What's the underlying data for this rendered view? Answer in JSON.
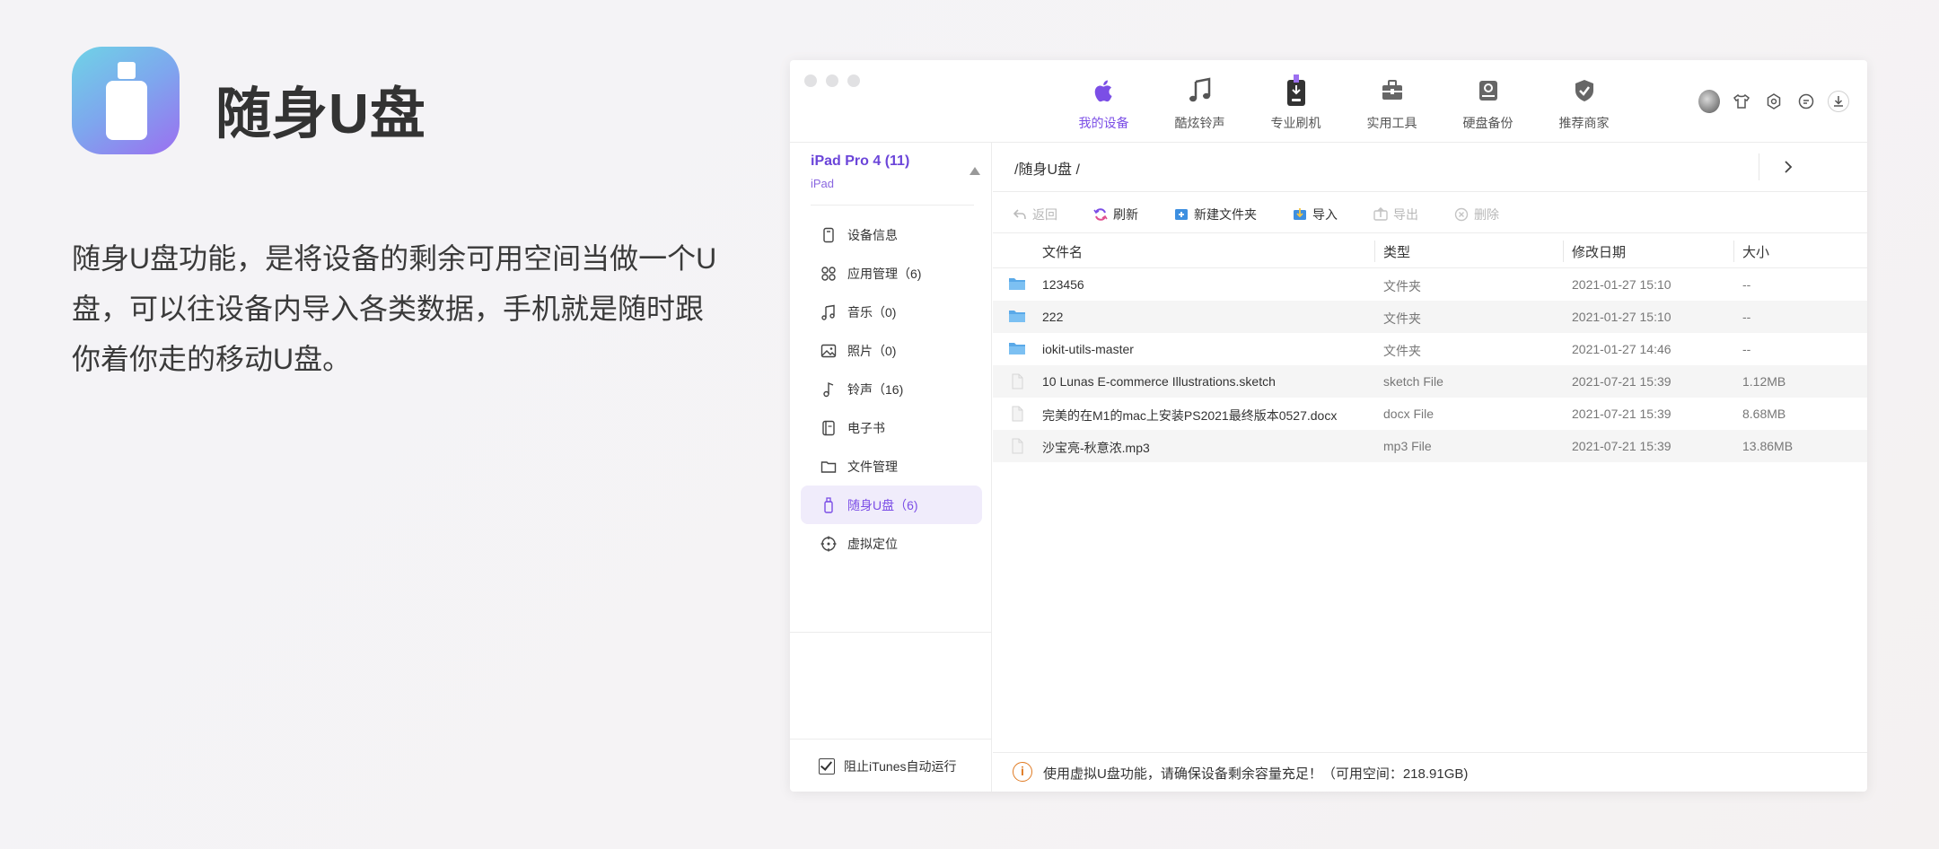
{
  "hero": {
    "title": "随身U盘",
    "description": "随身U盘功能，是将设备的剩余可用空间当做一个U盘，可以往设备内导入各类数据，手机就是随时跟你着你走的移动U盘。"
  },
  "colors": {
    "accent": "#7b4ee6",
    "folder": "#5aa9e8",
    "warning": "#e07a22"
  },
  "nav": {
    "tabs": [
      {
        "label": "我的设备",
        "icon": "apple-icon",
        "active": true
      },
      {
        "label": "酷炫铃声",
        "icon": "music-note-icon"
      },
      {
        "label": "专业刷机",
        "icon": "phone-flash-icon"
      },
      {
        "label": "实用工具",
        "icon": "toolbox-icon"
      },
      {
        "label": "硬盘备份",
        "icon": "hard-drive-backup-icon"
      },
      {
        "label": "推荐商家",
        "icon": "shield-check-icon"
      }
    ]
  },
  "device": {
    "name": "iPad Pro 4 (11)",
    "type": "iPad"
  },
  "sidebar": {
    "items": [
      {
        "label": "设备信息",
        "icon": "device-info-icon"
      },
      {
        "label": "应用管理（6)",
        "icon": "apps-icon"
      },
      {
        "label": "音乐（0)",
        "icon": "music-icon"
      },
      {
        "label": "照片（0)",
        "icon": "photo-icon"
      },
      {
        "label": "铃声（16)",
        "icon": "ringtone-icon"
      },
      {
        "label": "电子书",
        "icon": "ebook-icon"
      },
      {
        "label": "文件管理",
        "icon": "folder-icon"
      },
      {
        "label": "随身U盘（6)",
        "icon": "usb-drive-icon",
        "active": true
      },
      {
        "label": "虚拟定位",
        "icon": "location-target-icon"
      }
    ],
    "itunes_label": "阻止iTunes自动运行"
  },
  "main": {
    "path": "/随身U盘 /",
    "toolbar": {
      "back": "返回",
      "refresh": "刷新",
      "new_folder": "新建文件夹",
      "import": "导入",
      "export": "导出",
      "delete": "删除"
    },
    "columns": [
      "文件名",
      "类型",
      "修改日期",
      "大小"
    ],
    "rows": [
      {
        "name": "123456",
        "type": "文件夹",
        "date": "2021-01-27 15:10",
        "size": "--",
        "kind": "folder"
      },
      {
        "name": "222",
        "type": "文件夹",
        "date": "2021-01-27 15:10",
        "size": "--",
        "kind": "folder"
      },
      {
        "name": "iokit-utils-master",
        "type": "文件夹",
        "date": "2021-01-27 14:46",
        "size": "--",
        "kind": "folder"
      },
      {
        "name": "10 Lunas E-commerce Illustrations.sketch",
        "type": "sketch File",
        "date": "2021-07-21 15:39",
        "size": "1.12MB",
        "kind": "file"
      },
      {
        "name": "完美的在M1的mac上安装PS2021最终版本0527.docx",
        "type": "docx File",
        "date": "2021-07-21 15:39",
        "size": "8.68MB",
        "kind": "file"
      },
      {
        "name": "沙宝亮-秋意浓.mp3",
        "type": "mp3 File",
        "date": "2021-07-21 15:39",
        "size": "13.86MB",
        "kind": "file"
      }
    ],
    "status": "使用虚拟U盘功能，请确保设备剩余容量充足！（可用空间：218.91GB)"
  }
}
